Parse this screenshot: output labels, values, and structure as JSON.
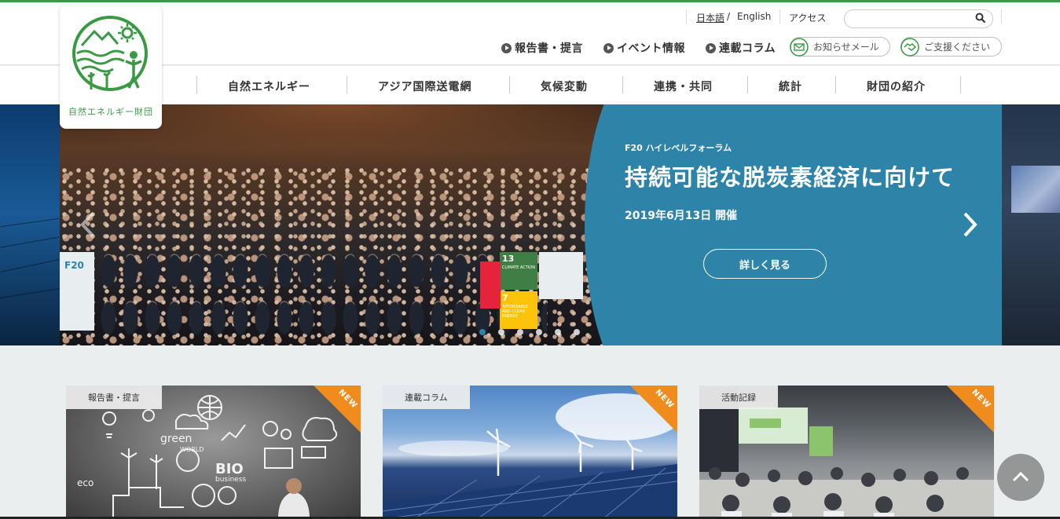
{
  "brand": {
    "logo_text": "自然エネルギー財団",
    "accent_color": "#3a9a44"
  },
  "utility": {
    "lang_ja": "日本語",
    "lang_sep": "/",
    "lang_en": "English",
    "access": "アクセス",
    "search_placeholder": ""
  },
  "topnav": [
    {
      "label": "報告書・提言",
      "icon": "play-circle-icon"
    },
    {
      "label": "イベント情報",
      "icon": "play-circle-icon"
    },
    {
      "label": "連載コラム",
      "icon": "play-circle-icon"
    }
  ],
  "pills": {
    "mail": {
      "label": "お知らせメール",
      "icon": "mail-icon"
    },
    "support": {
      "label": "ご支援ください",
      "icon": "handshake-icon"
    }
  },
  "mainnav": [
    "自然エネルギー",
    "アジア国際送電網",
    "気候変動",
    "連携・共同",
    "統計",
    "財団の紹介"
  ],
  "hero": {
    "eyebrow": "F20 ハイレベルフォーラム",
    "title": "持続可能な脱炭素経済に向けて",
    "date": "2019年6月13日 開催",
    "button": "詳しく見る",
    "slides_total": 6,
    "active_slide": 1,
    "panel_color": "#2d84a8",
    "photo_labels": {
      "f20": "F20",
      "sdg13_number": "13",
      "sdg13_text": "CLIMATE ACTION",
      "sdg7_number": "7",
      "sdg7_text": "AFFORDABLE AND CLEAN ENERGY"
    }
  },
  "cards": [
    {
      "tag": "報告書・提言",
      "badge": "NEW"
    },
    {
      "tag": "連載コラム",
      "badge": "NEW"
    },
    {
      "tag": "活動記録",
      "badge": "NEW"
    }
  ],
  "card_image_text": {
    "green": "green",
    "world": "WORLD",
    "bio": "BIO",
    "business": "business",
    "eco": "eco"
  }
}
